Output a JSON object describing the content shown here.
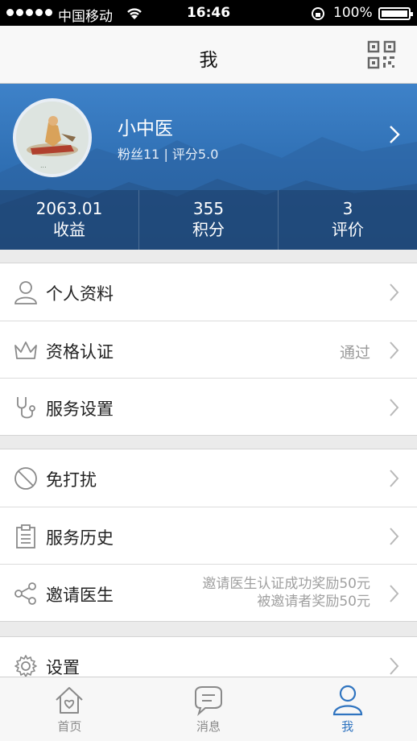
{
  "status_bar": {
    "carrier": "中国移动",
    "time": "16:46",
    "battery": "100%"
  },
  "nav": {
    "title": "我",
    "right_icon": "qr-code-icon"
  },
  "profile": {
    "name": "小中医",
    "meta": "粉丝11 | 评分5.0",
    "stats": [
      {
        "value": "2063.01",
        "label": "收益"
      },
      {
        "value": "355",
        "label": "积分"
      },
      {
        "value": "3",
        "label": "评价"
      }
    ]
  },
  "menu_group_1": [
    {
      "label": "个人资料",
      "icon": "person-icon",
      "value": ""
    },
    {
      "label": "资格认证",
      "icon": "crown-icon",
      "value": "通过"
    },
    {
      "label": "服务设置",
      "icon": "stethoscope-icon",
      "value": ""
    }
  ],
  "menu_group_2": [
    {
      "label": "免打扰",
      "icon": "no-disturb-icon",
      "value": ""
    },
    {
      "label": "服务历史",
      "icon": "clipboard-icon",
      "value": ""
    },
    {
      "label": "邀请医生",
      "icon": "share-icon",
      "value_line1": "邀请医生认证成功奖励50元",
      "value_line2": "被邀请者奖励50元"
    }
  ],
  "menu_group_3": [
    {
      "label": "设置",
      "icon": "gear-icon"
    }
  ],
  "tab_bar": {
    "tabs": [
      {
        "label": "首页",
        "icon": "home-icon"
      },
      {
        "label": "消息",
        "icon": "message-icon"
      },
      {
        "label": "我",
        "icon": "profile-icon"
      }
    ],
    "active_color": "#2f74c0"
  },
  "colors": {
    "header_blue": "#3e82c9",
    "background": "#ebebeb"
  }
}
